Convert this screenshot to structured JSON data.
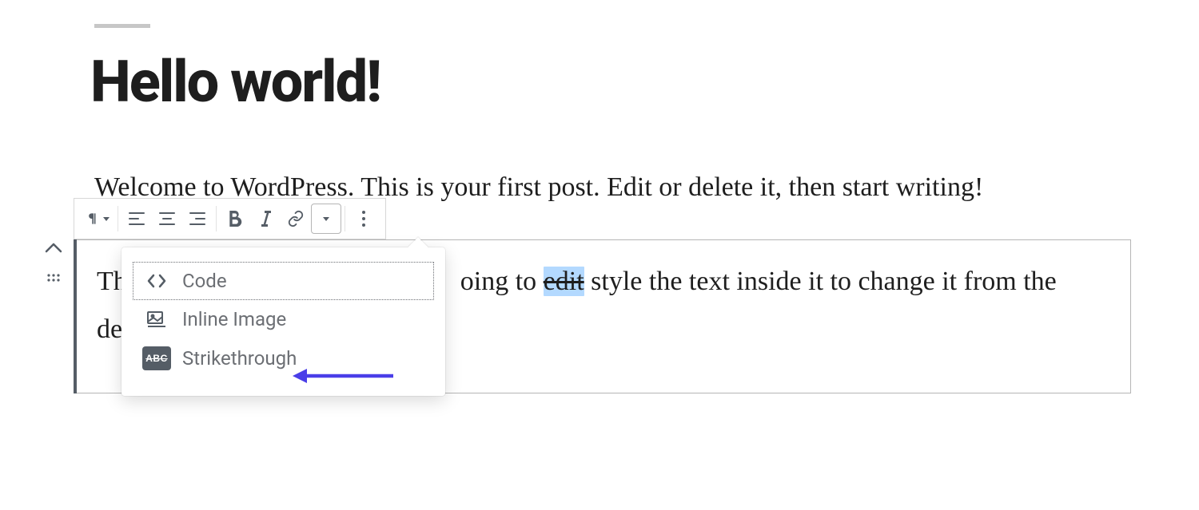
{
  "post": {
    "title": "Hello world!",
    "intro": "Welcome to WordPress. This is your first post. Edit or delete it, then start writing!"
  },
  "block": {
    "text_before": "Th",
    "text_mid_a": "oing to ",
    "highlighted_word": "edit",
    "text_mid_b": " style the text inside it to change it from the",
    "text_line2_a": "de"
  },
  "popover": {
    "items": {
      "code": "Code",
      "inline_image": "Inline Image",
      "strikethrough": "Strikethrough",
      "strikethrough_badge": "ABC"
    }
  }
}
